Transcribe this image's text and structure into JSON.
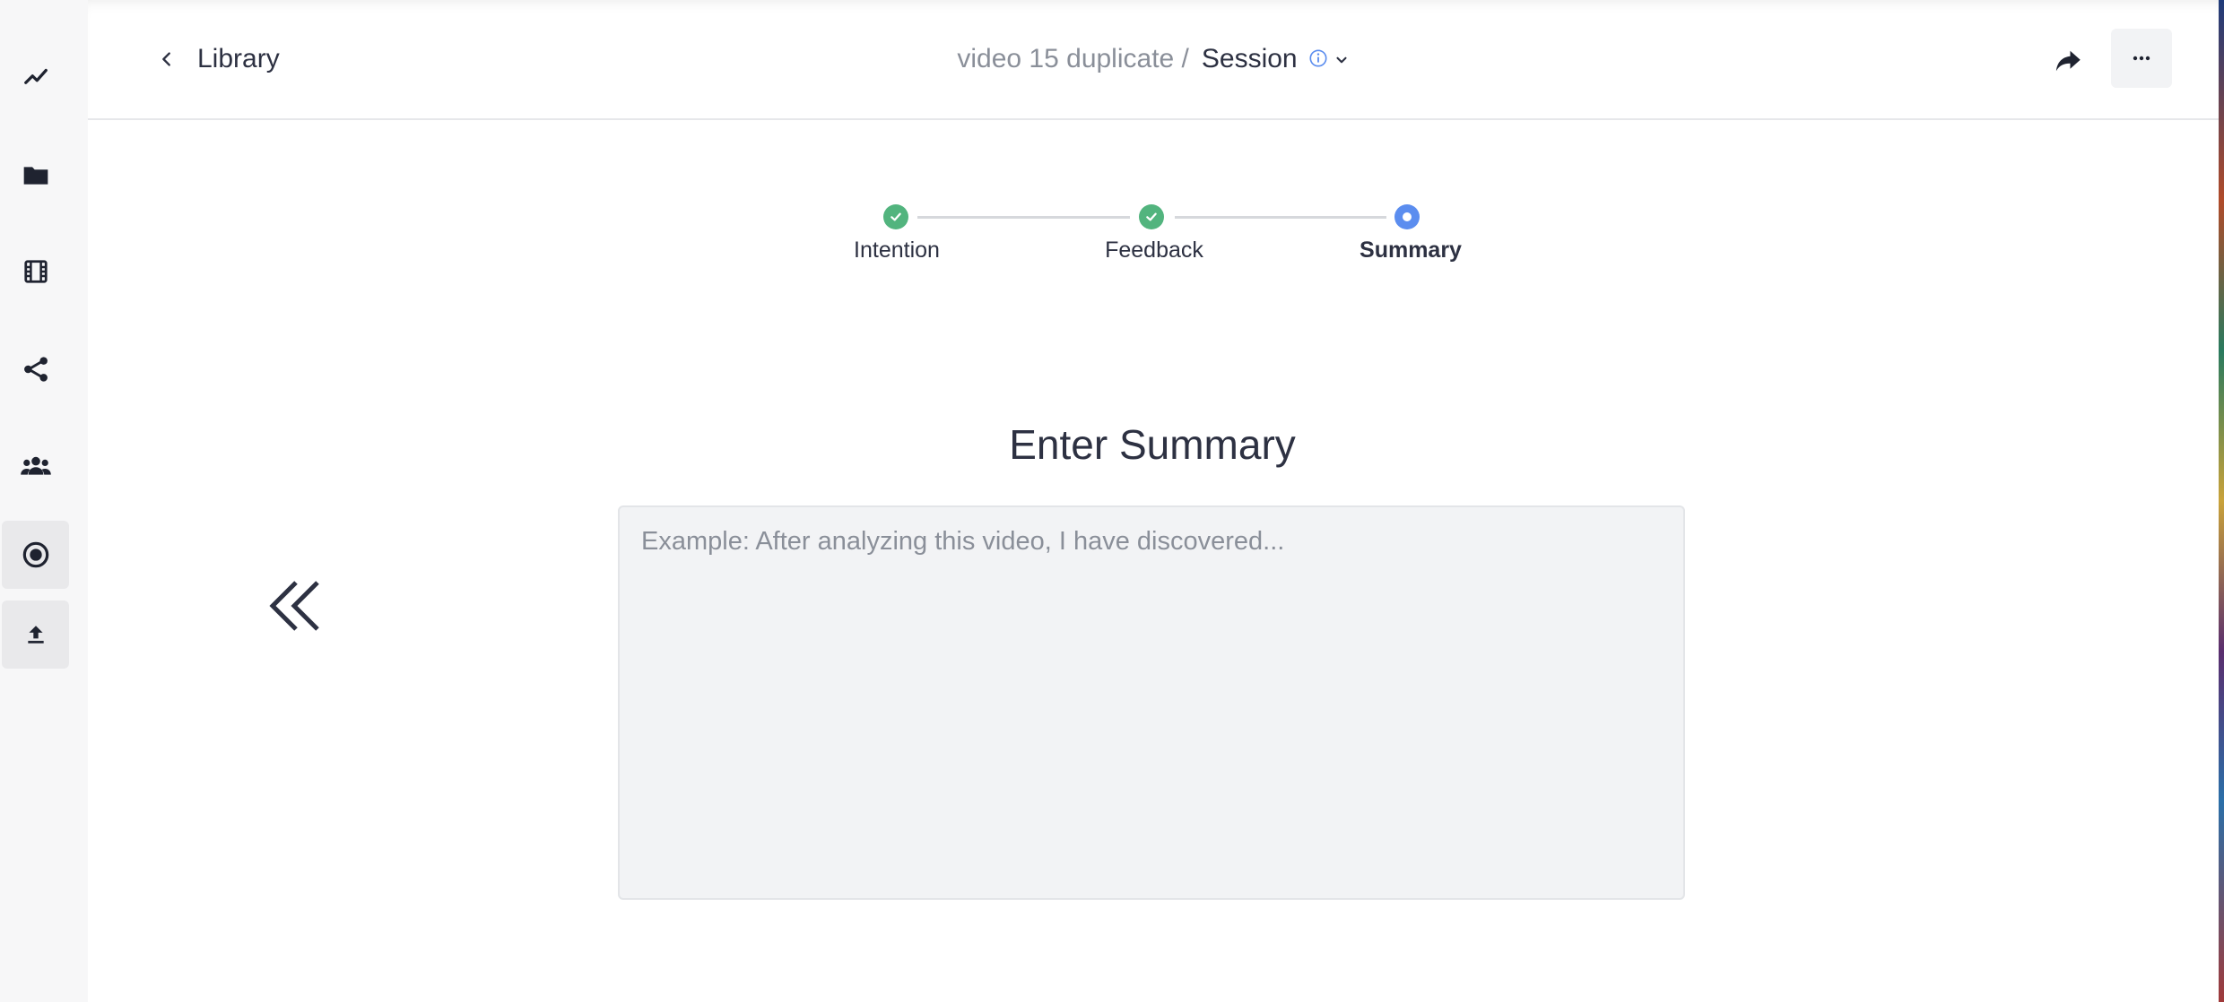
{
  "header": {
    "back_label": "Library",
    "breadcrumb_parent": "video 15 duplicate /",
    "breadcrumb_current": "Session"
  },
  "sidebar": {
    "items": [
      {
        "icon": "activity-icon"
      },
      {
        "icon": "folder-icon"
      },
      {
        "icon": "film-icon"
      },
      {
        "icon": "share-nodes-icon"
      },
      {
        "icon": "users-icon"
      },
      {
        "icon": "record-icon"
      },
      {
        "icon": "upload-icon"
      }
    ]
  },
  "stepper": {
    "steps": [
      {
        "label": "Intention",
        "status": "complete"
      },
      {
        "label": "Feedback",
        "status": "complete"
      },
      {
        "label": "Summary",
        "status": "current"
      }
    ]
  },
  "summary": {
    "title": "Enter Summary",
    "value": "",
    "placeholder": "Example: After analyzing this video, I have discovered..."
  },
  "colors": {
    "step_complete": "#52b47e",
    "step_current": "#5b8def",
    "text_primary": "#2d3142",
    "text_muted": "#8a8f99"
  }
}
